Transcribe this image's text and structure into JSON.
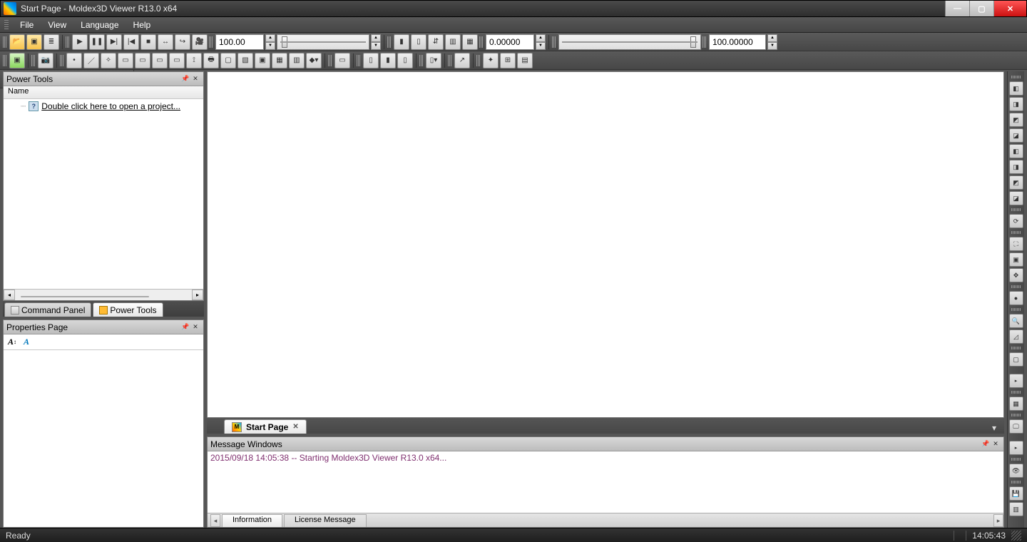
{
  "window": {
    "title": "Start Page - Moldex3D Viewer R13.0  x64"
  },
  "menu": {
    "items": [
      "File",
      "View",
      "Language",
      "Help"
    ]
  },
  "toolbar1": {
    "input1": "100.00",
    "input2": "0.00000",
    "input3": "100.00000"
  },
  "powertools": {
    "title": "Power Tools",
    "header": "Name",
    "opentext": "Double click here to open a project..."
  },
  "lefttabs": {
    "command": "Command Panel",
    "power": "Power Tools"
  },
  "properties": {
    "title": "Properties Page"
  },
  "viewtab": {
    "label": "Start Page"
  },
  "msgwin": {
    "title": "Message Windows",
    "line1": "2015/09/18 14:05:38 -- Starting Moldex3D Viewer R13.0  x64...",
    "tab1": "Information",
    "tab2": "License Message"
  },
  "status": {
    "ready": "Ready",
    "time": "14:05:43"
  }
}
